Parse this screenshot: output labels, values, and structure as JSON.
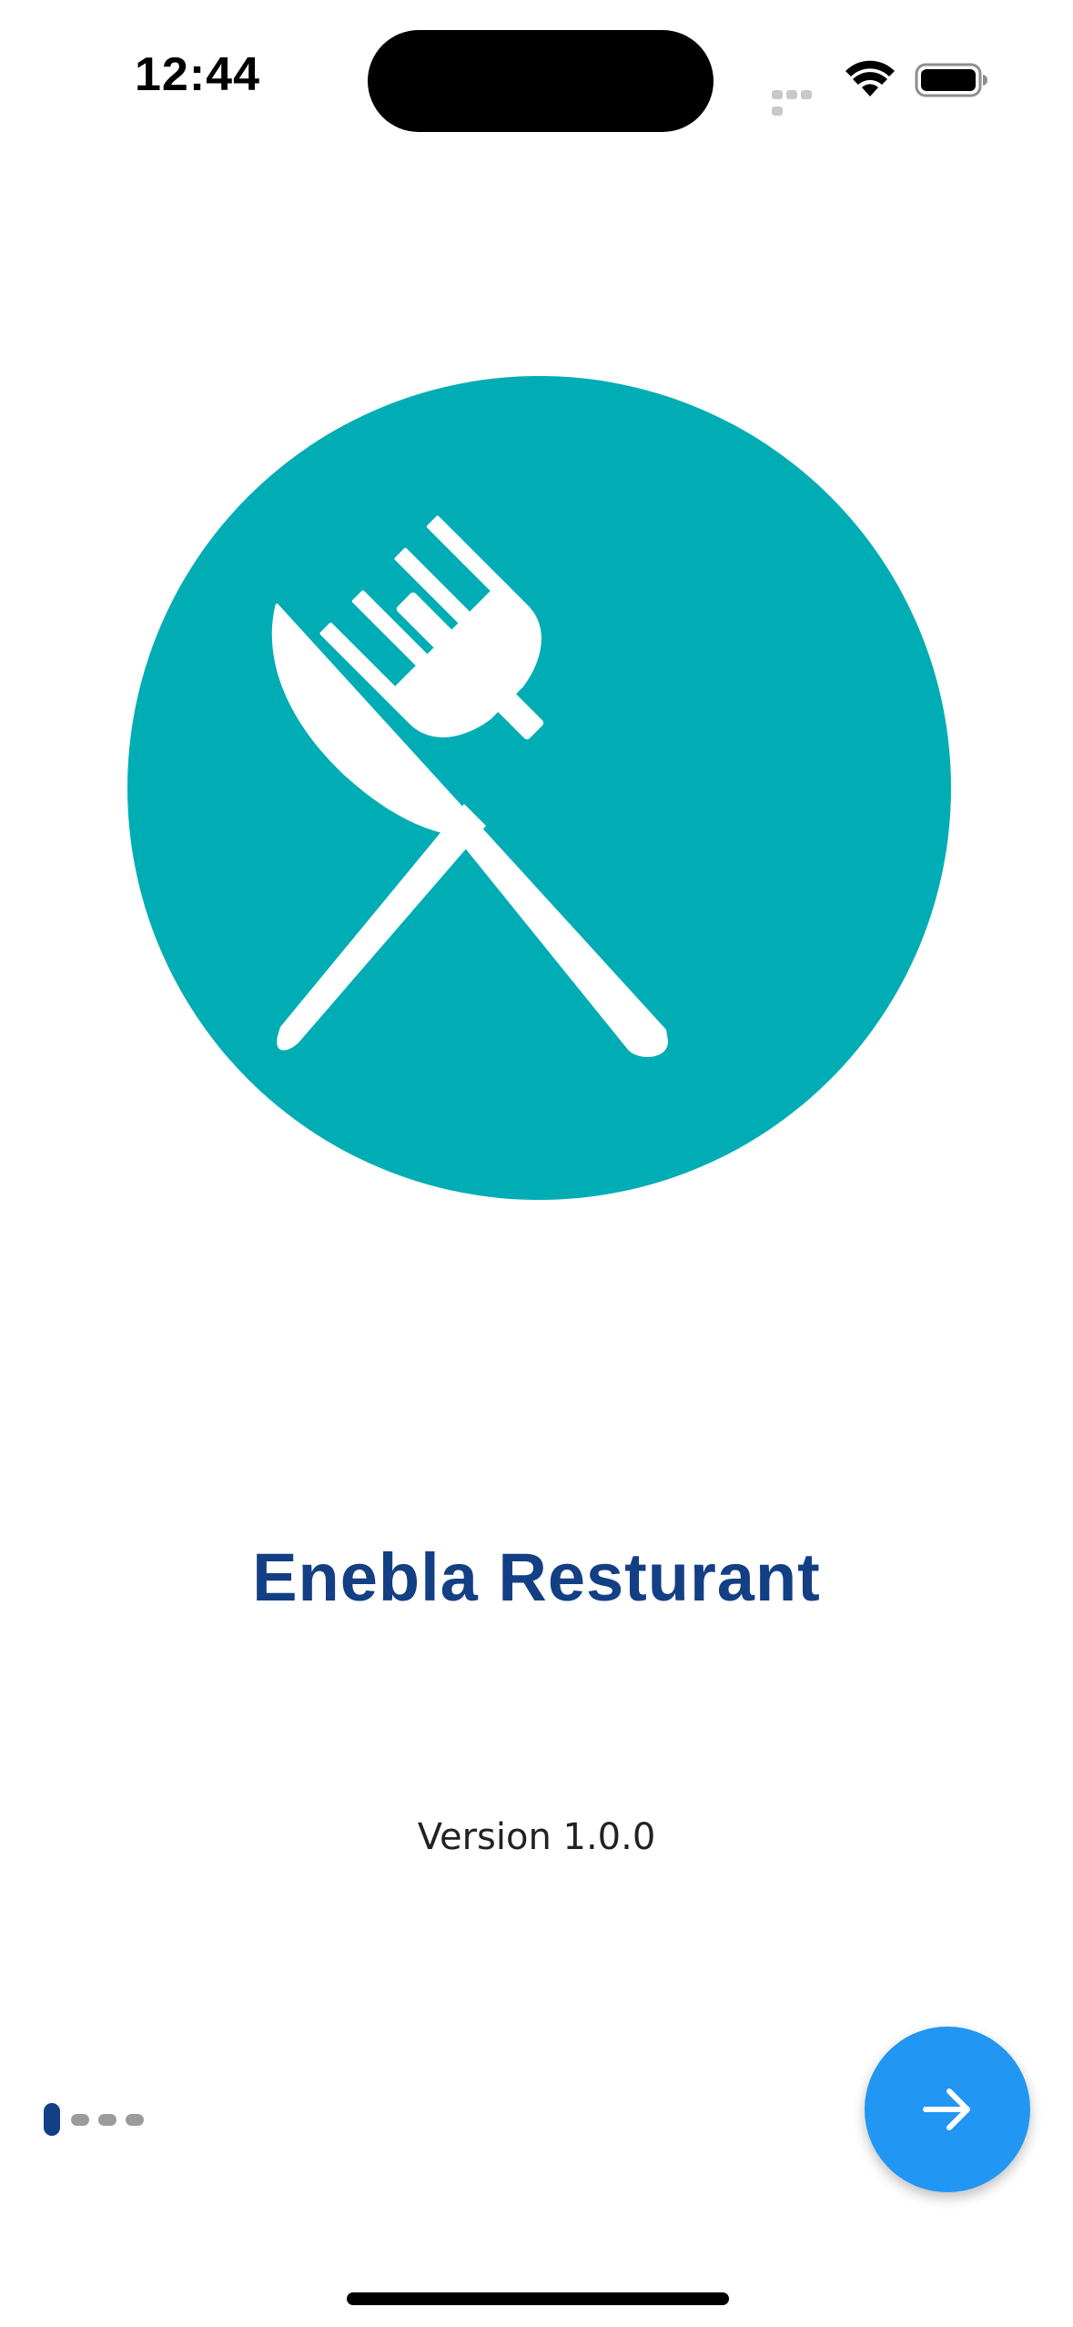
{
  "status_bar": {
    "time": "12:44",
    "icons": [
      "cellular-signal-icon",
      "wifi-icon",
      "battery-icon"
    ]
  },
  "logo": {
    "icon": "fork-and-knife-icon",
    "circle_color": "#00adb5"
  },
  "app": {
    "title": "Enebla Resturant",
    "version": "Version 1.0.0"
  },
  "onboarding": {
    "pages": 4,
    "current_page": 1
  },
  "next_button": {
    "icon": "arrow-right-icon",
    "color": "#2196f3"
  },
  "colors": {
    "title": "#133f84",
    "active_indicator": "#133f84",
    "inactive_indicator": "#9b9b9b"
  }
}
